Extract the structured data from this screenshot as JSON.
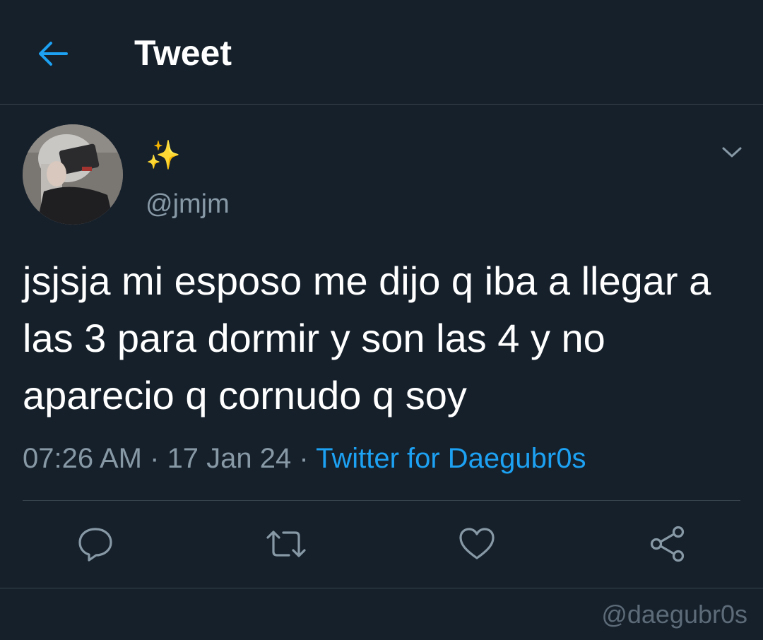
{
  "header": {
    "title": "Tweet",
    "back_icon": "arrow-left-icon"
  },
  "tweet": {
    "display_name": "✨",
    "handle": "@jmjm",
    "text": "jsjsja mi esposo me dijo q iba a llegar a las 3 para dormir y son las 4 y no aparecio q cornudo q soy",
    "time": "07:26 AM",
    "separator": " · ",
    "date": "17 Jan 24",
    "source": "Twitter for Daegubr0s",
    "menu_icon": "chevron-down-icon"
  },
  "actions": {
    "reply_icon": "reply-icon",
    "retweet_icon": "retweet-icon",
    "like_icon": "heart-icon",
    "share_icon": "share-icon"
  },
  "watermark": "@daegubr0s",
  "colors": {
    "background": "#15202b",
    "accent": "#1da1f2",
    "secondary_text": "#8899a6",
    "divider": "#38444d"
  }
}
